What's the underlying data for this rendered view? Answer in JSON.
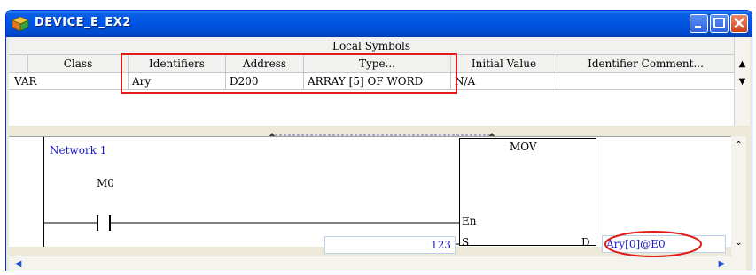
{
  "window": {
    "title": "DEVICE_E_EX2"
  },
  "table": {
    "caption": "Local Symbols",
    "columns": [
      "Class",
      "Identifiers",
      "Address",
      "Type...",
      "Initial Value",
      "Identifier Comment..."
    ],
    "rows": [
      [
        "VAR",
        "Ary",
        "D200",
        "ARRAY [5] OF WORD",
        "N/A",
        ""
      ]
    ]
  },
  "ladder": {
    "network_label": "Network 1",
    "contact_label": "M0",
    "instruction": "MOV",
    "pin_en": "En",
    "pin_s": "S",
    "pin_d": "D",
    "source_value": "123",
    "dest_value": "Ary[0]@E0"
  },
  "colors": {
    "titlebar": "#0054e3",
    "highlight": "#e21b1b",
    "operand_text": "#1a1acc"
  }
}
